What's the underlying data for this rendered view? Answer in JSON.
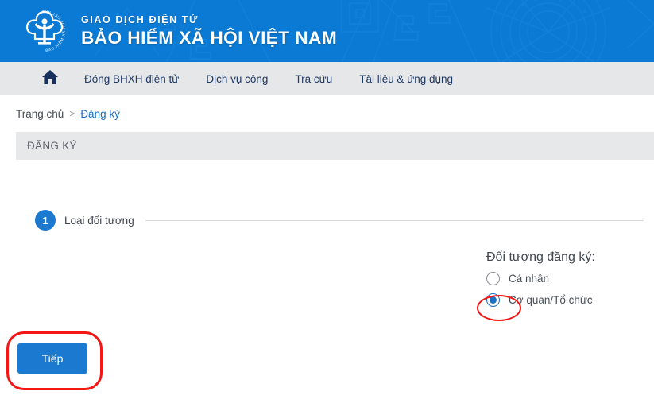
{
  "header": {
    "logo_icon": "bhxh-emblem-logo",
    "logo_ring_text": "BẢO HIỂM XÃ HỘI VIỆT NAM",
    "tagline": "GIAO DỊCH ĐIỆN TỬ",
    "title": "BẢO HIỂM XÃ HỘI VIỆT NAM",
    "background_color": "#0b7ad4",
    "text_color": "#ffffff"
  },
  "nav": {
    "home_icon": "home-icon",
    "background_color": "#e6e7e9",
    "text_color": "#1f3864",
    "items": [
      {
        "label": "Đóng BHXH điện tử"
      },
      {
        "label": "Dịch vụ công"
      },
      {
        "label": "Tra cứu"
      },
      {
        "label": "Tài liệu & ứng dụng"
      }
    ]
  },
  "breadcrumb": {
    "home": "Trang chủ",
    "separator": ">",
    "current": "Đăng ký",
    "link_color": "#1b6fc4"
  },
  "page": {
    "title": "ĐĂNG KÝ",
    "title_bar_color": "#e7e8ea"
  },
  "step": {
    "number": "1",
    "label": "Loại đối tượng",
    "badge_color": "#1b7ad0"
  },
  "radio_group": {
    "title": "Đối tượng đăng ký:",
    "options": [
      {
        "label": "Cá nhân",
        "selected": false
      },
      {
        "label": "Cơ quan/Tổ chức",
        "selected": true
      }
    ],
    "selected_color": "#1b6fc4"
  },
  "actions": {
    "next_label": "Tiếp",
    "next_color": "#1b7ad0"
  },
  "annotations": {
    "color": "#f51616",
    "shapes": [
      {
        "name": "highlight-next-button",
        "type": "rounded-rect"
      },
      {
        "name": "highlight-selected-radio",
        "type": "ellipse"
      }
    ]
  }
}
